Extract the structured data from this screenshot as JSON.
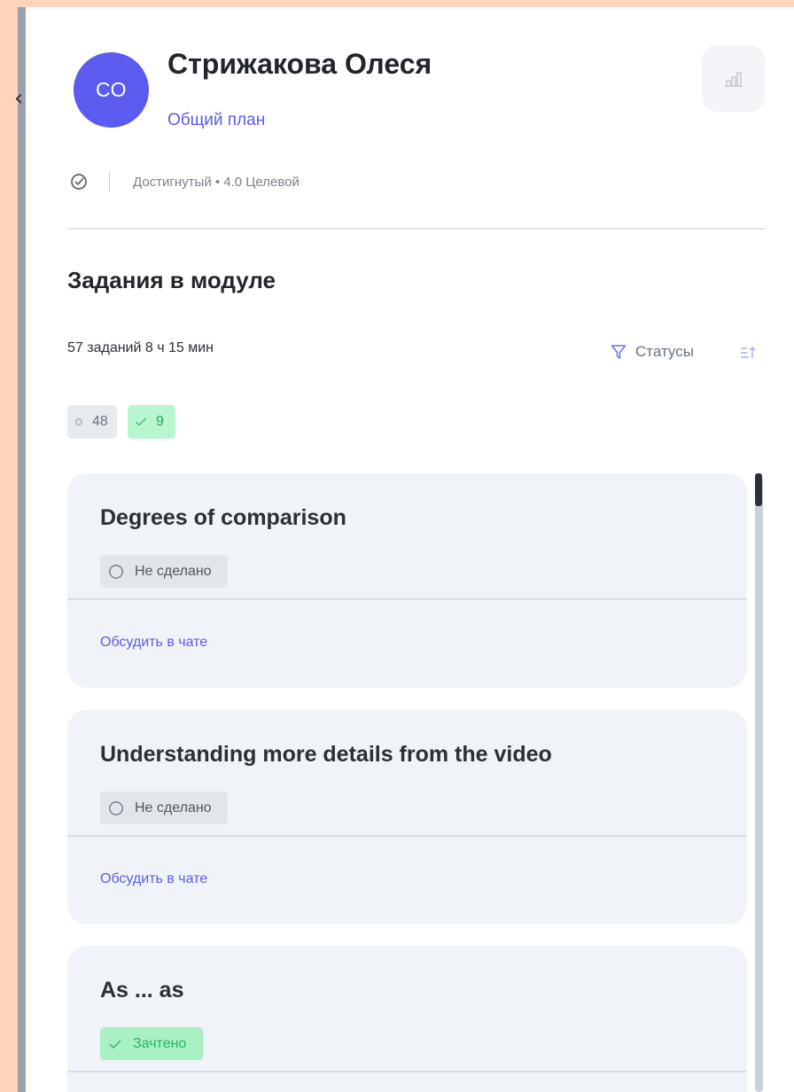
{
  "profile": {
    "initials": "СО",
    "name": "Стрижакова Олеся",
    "plan_link": "Общий план",
    "goal_text": "Достигнутый • 4.0 Целевой"
  },
  "module": {
    "title": "Задания в модуле",
    "summary": "57 заданий 8 ч 15 мин",
    "statuses_label": "Статусы",
    "chips": [
      {
        "icon": "circle-icon",
        "count": "48"
      },
      {
        "icon": "check-icon",
        "count": "9"
      }
    ]
  },
  "tasks": [
    {
      "title": "Degrees of comparison",
      "status": "Не сделано",
      "status_type": "todo",
      "chat_link": "Обсудить в чате"
    },
    {
      "title": "Understanding more details from the video",
      "status": "Не сделано",
      "status_type": "todo",
      "chat_link": "Обсудить в чате"
    },
    {
      "title": "As ... as",
      "status": "Зачтено",
      "status_type": "done"
    }
  ],
  "colors": {
    "accent": "#5b5bf0",
    "success_bg": "#a9f0c4",
    "success_text": "#2bb463",
    "frame": "#ffd4b8"
  }
}
